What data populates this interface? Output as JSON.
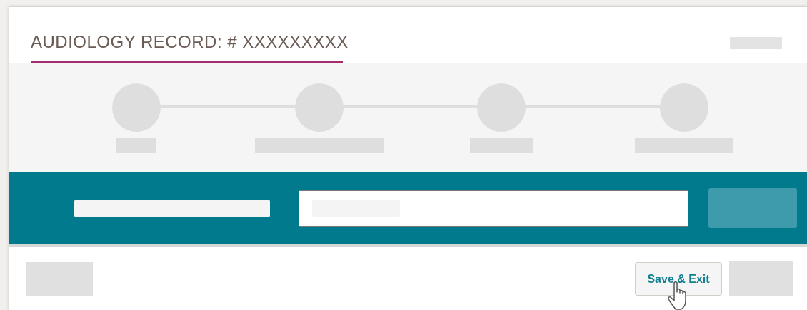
{
  "record": {
    "title": "AUDIOLOGY RECORD: # XXXXXXXXX"
  },
  "footer": {
    "buttons": [
      {
        "label": "Save & Exit"
      }
    ]
  }
}
